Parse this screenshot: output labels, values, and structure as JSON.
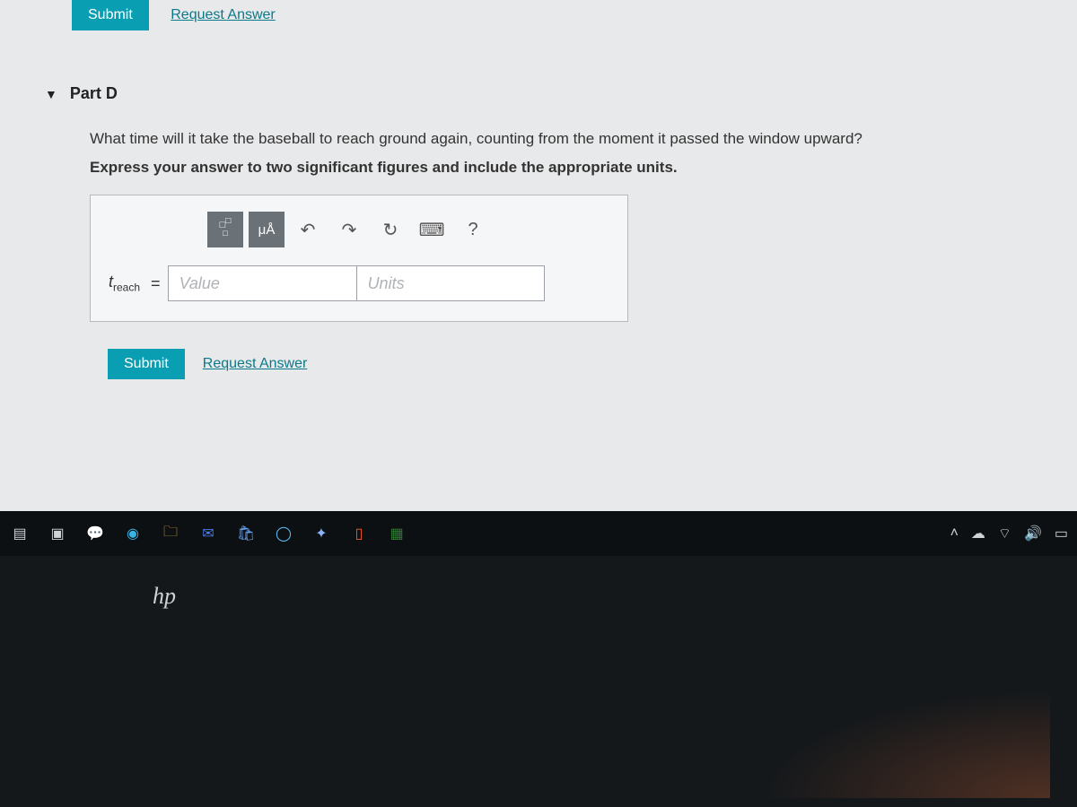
{
  "topActions": {
    "submit": "Submit",
    "request": "Request Answer"
  },
  "part": {
    "label": "Part D"
  },
  "question": "What time will it take the baseball to reach ground again, counting from the moment it passed the window upward?",
  "instruction": "Express your answer to two significant figures and include the appropriate units.",
  "toolbar": {
    "microA": "μÅ",
    "help": "?"
  },
  "variable": {
    "name": "t",
    "subscript": "reach",
    "equals": "="
  },
  "fields": {
    "valuePlaceholder": "Value",
    "unitsPlaceholder": "Units"
  },
  "lowerActions": {
    "submit": "Submit",
    "request": "Request Answer"
  },
  "logo": "hp"
}
